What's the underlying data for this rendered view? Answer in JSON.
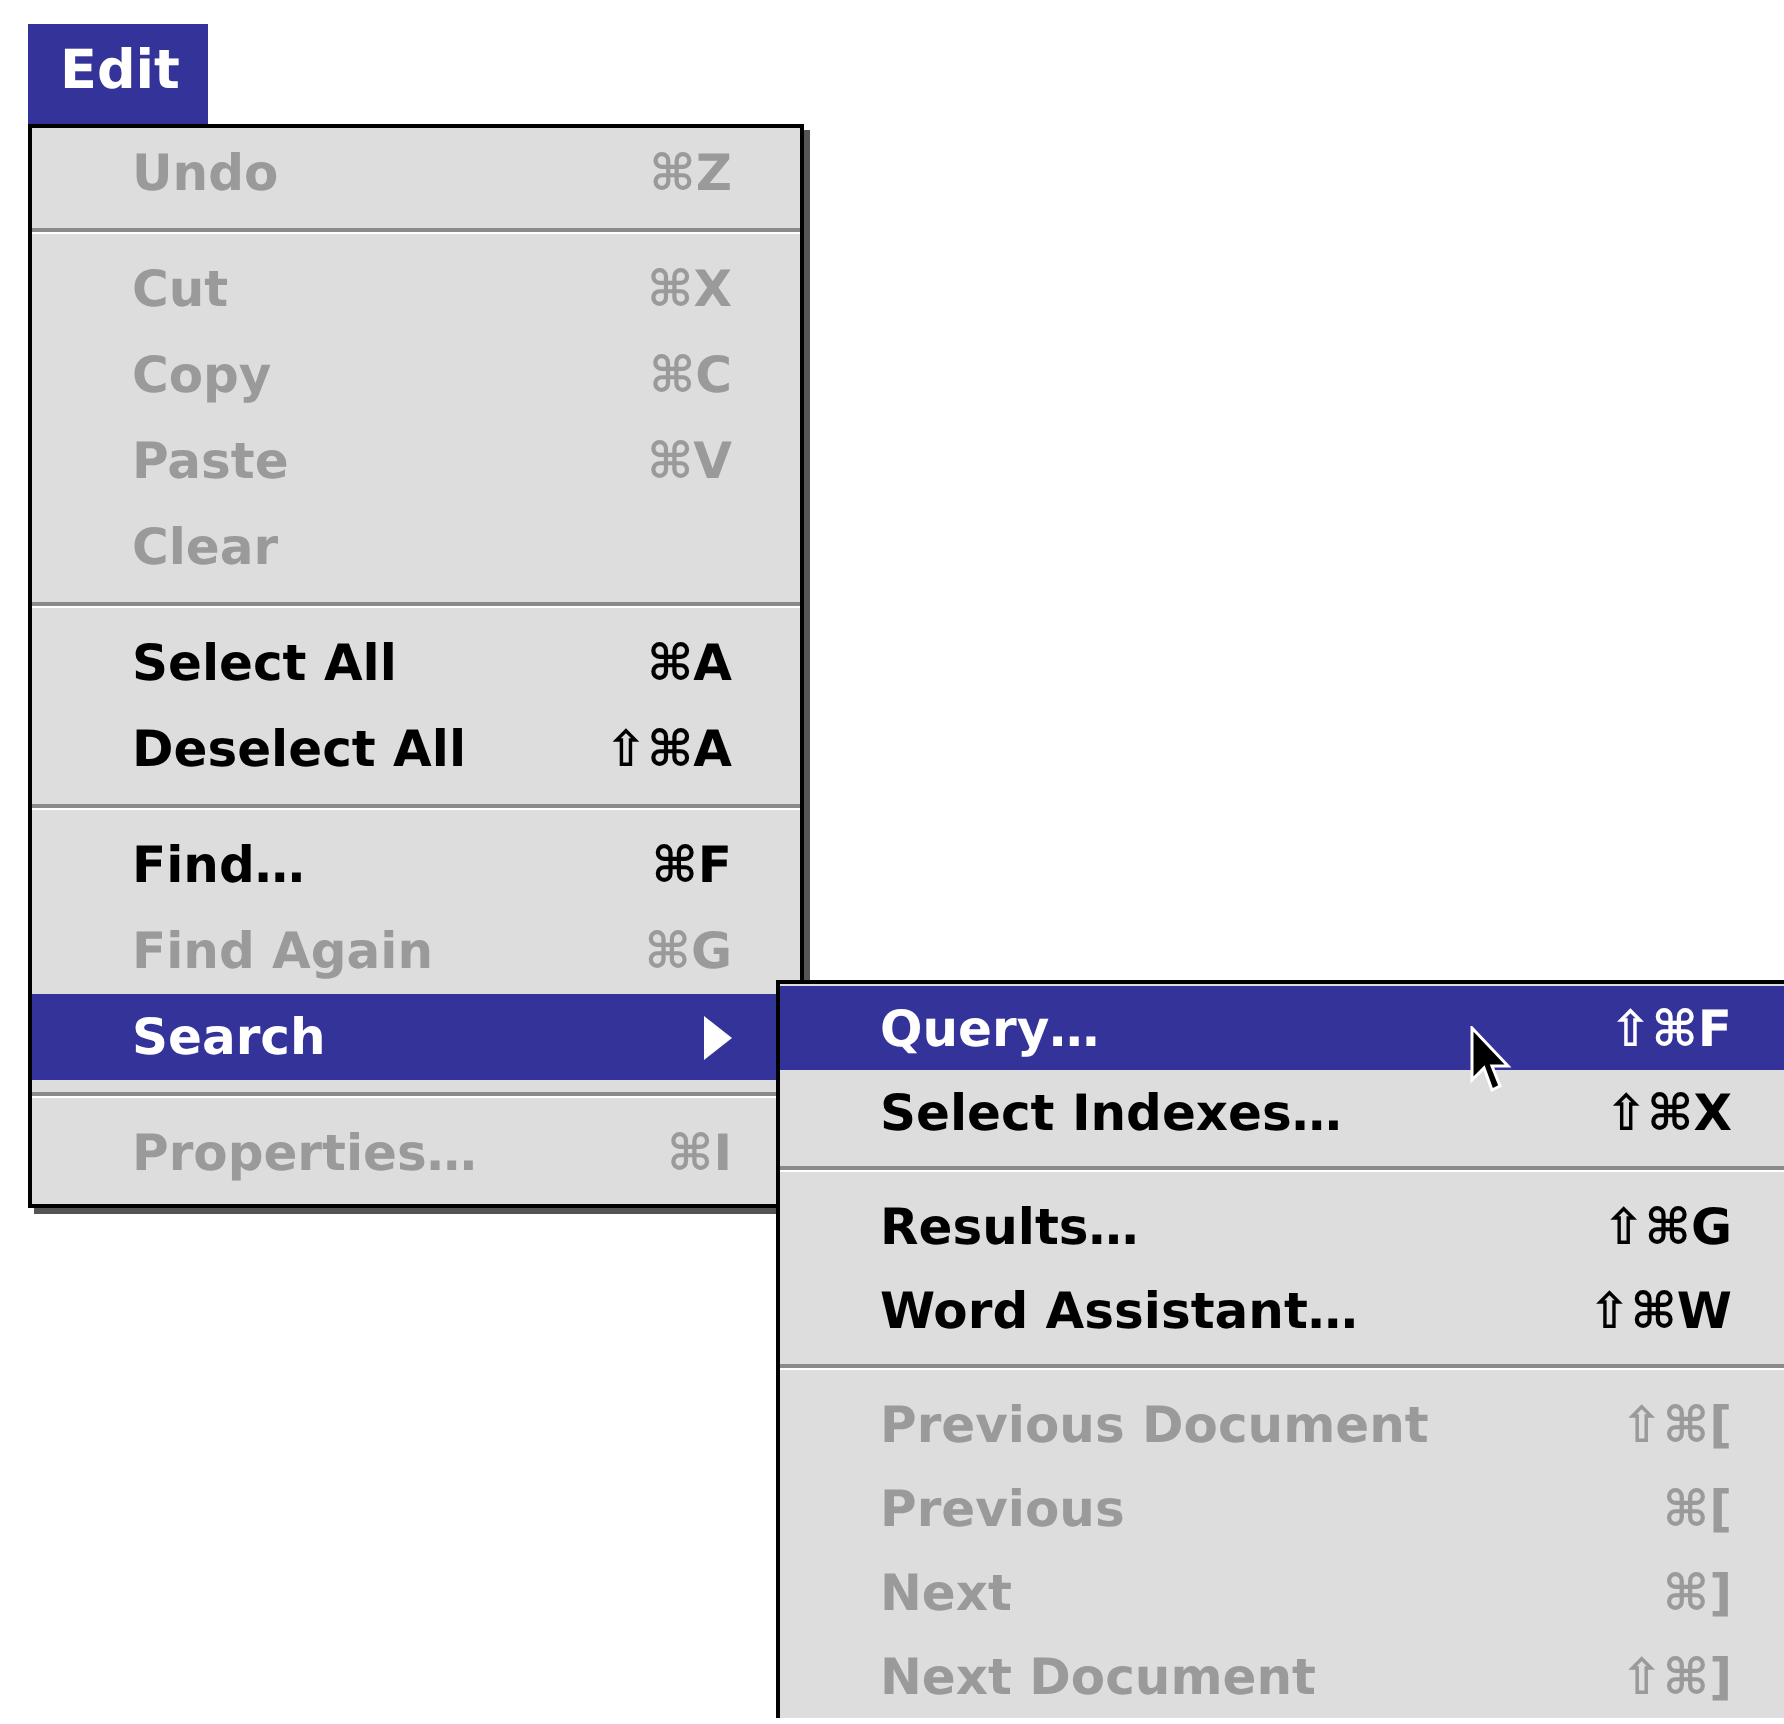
{
  "menu_title": "Edit",
  "items": [
    {
      "kind": "item",
      "label": "Undo",
      "shortcut": "⌘Z",
      "disabled": true,
      "selected": false
    },
    {
      "kind": "separator"
    },
    {
      "kind": "item",
      "label": "Cut",
      "shortcut": "⌘X",
      "disabled": true,
      "selected": false
    },
    {
      "kind": "item",
      "label": "Copy",
      "shortcut": "⌘C",
      "disabled": true,
      "selected": false
    },
    {
      "kind": "item",
      "label": "Paste",
      "shortcut": "⌘V",
      "disabled": true,
      "selected": false
    },
    {
      "kind": "item",
      "label": "Clear",
      "disabled": true,
      "selected": false
    },
    {
      "kind": "separator"
    },
    {
      "kind": "item",
      "label": "Select All",
      "shortcut": "⌘A",
      "disabled": false,
      "selected": false
    },
    {
      "kind": "item",
      "label": "Deselect All",
      "shortcut": "⇧⌘A",
      "disabled": false,
      "selected": false
    },
    {
      "kind": "separator"
    },
    {
      "kind": "item",
      "label": "Find…",
      "shortcut": "⌘F",
      "disabled": false,
      "selected": false
    },
    {
      "kind": "item",
      "label": "Find Again",
      "shortcut": "⌘G",
      "disabled": true,
      "selected": false
    },
    {
      "kind": "submenu",
      "label": "Search",
      "disabled": false,
      "selected": true
    },
    {
      "kind": "separator"
    },
    {
      "kind": "item",
      "label": "Properties…",
      "shortcut": "⌘I",
      "disabled": true,
      "selected": false
    }
  ],
  "submenu": [
    {
      "kind": "item",
      "label": "Query…",
      "shortcut": "⇧⌘F",
      "disabled": false,
      "selected": true
    },
    {
      "kind": "item",
      "label": "Select Indexes…",
      "shortcut": "⇧⌘X",
      "disabled": false,
      "selected": false
    },
    {
      "kind": "separator"
    },
    {
      "kind": "item",
      "label": "Results…",
      "shortcut": "⇧⌘G",
      "disabled": false,
      "selected": false
    },
    {
      "kind": "item",
      "label": "Word Assistant…",
      "shortcut": "⇧⌘W",
      "disabled": false,
      "selected": false
    },
    {
      "kind": "separator"
    },
    {
      "kind": "item",
      "label": "Previous Document",
      "shortcut": "⇧⌘[",
      "disabled": true,
      "selected": false
    },
    {
      "kind": "item",
      "label": "Previous",
      "shortcut": "⌘[",
      "disabled": true,
      "selected": false
    },
    {
      "kind": "item",
      "label": "Next",
      "shortcut": "⌘]",
      "disabled": true,
      "selected": false
    },
    {
      "kind": "item",
      "label": "Next Document",
      "shortcut": "⇧⌘]",
      "disabled": true,
      "selected": false
    }
  ]
}
